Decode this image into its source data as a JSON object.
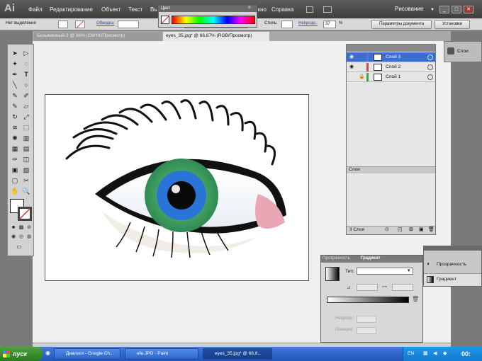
{
  "app": {
    "logo": "Ai",
    "menu": [
      "Файл",
      "Редактирование",
      "Объект",
      "Текст",
      "Выделение",
      "Эффект",
      "Просмотр",
      "Окно",
      "Справка"
    ],
    "workspace": "Рисование"
  },
  "controlbar": {
    "no_selection": "Нет выделения",
    "stroke_label": "Обводка:",
    "style_label": "Стиль:",
    "opacity_label": "Непрозр.:",
    "opacity_value": "37",
    "percent": "%",
    "doc_settings": "Параметры документа",
    "preferences": "Установки"
  },
  "tabs": [
    {
      "label": "Безымянный-3 @ 96% (CMYK/Просмотр)",
      "active": false
    },
    {
      "label": "eyes_35.jpg* @ 66,67% (RGB/Просмотр)",
      "active": true
    }
  ],
  "color_panel": {
    "title": "Цвет"
  },
  "layers_panel": {
    "layers": [
      {
        "name": "Слой 3",
        "selected": true,
        "color": "#4f7bd6"
      },
      {
        "name": "Слой 2",
        "selected": false,
        "color": "#d24a4a"
      },
      {
        "name": "Слой 1",
        "selected": false,
        "color": "#4aa04a"
      }
    ],
    "tab": "Слои",
    "count": "3 Слоя"
  },
  "right_dock": {
    "label": "Слои"
  },
  "gradient_panel": {
    "tab_transparency": "Прозрачность",
    "tab_gradient": "Градиент",
    "type_label": "Тип:",
    "opacity_label": "Непрозр.:",
    "position_label": "Позиция:"
  },
  "transp_panel": {
    "item1": "Прозрачность",
    "item2": "Градиент"
  },
  "status": {
    "zoom": "66,67%",
    "page": "1"
  },
  "taskbar": {
    "start": "пуск",
    "tasks": [
      {
        "label": "Диалоги - Google Ch...",
        "active": false
      },
      {
        "label": "efe.JPG - Paint",
        "active": false
      },
      {
        "label": "eyes_35.jpg* @ 66,6...",
        "active": true
      }
    ],
    "lang": "EN",
    "clock": "00:"
  }
}
